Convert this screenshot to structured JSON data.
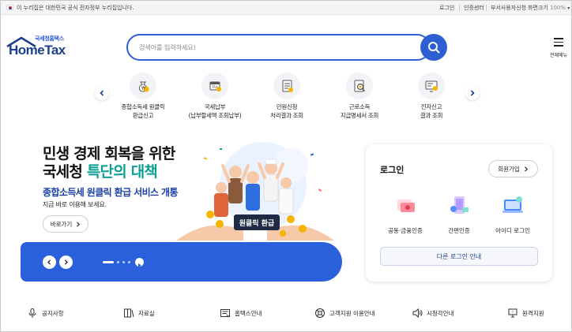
{
  "govbar": {
    "notice": "이 누리집은 대한민국 공식 전자정부 누리집입니다.",
    "links": [
      "로그인",
      "인증센터",
      "부서사용자신청"
    ],
    "zoom_label": "화면크기",
    "zoom_value": "100%"
  },
  "logo": {
    "sub": "국세청홈택스",
    "main": "HomeTax"
  },
  "search": {
    "placeholder": "검색어를 입력하세요!"
  },
  "allmenu": {
    "label": "전체메뉴"
  },
  "quick_menu": [
    {
      "line1": "종합소득세 원클릭",
      "line2": "환급신고",
      "icon": "money-bag-icon"
    },
    {
      "line1": "국세납부",
      "line2": "(납부할세액 조회납부)",
      "icon": "tax-bill-icon"
    },
    {
      "line1": "민원신청",
      "line2": "처리결과 조회",
      "icon": "document-list-icon"
    },
    {
      "line1": "근로소득",
      "line2": "지급명세서 조회",
      "icon": "document-search-icon"
    },
    {
      "line1": "전자신고",
      "line2": "결과 조회",
      "icon": "monitor-check-icon"
    }
  ],
  "hero": {
    "title_line1": "민생 경제 회복을 위한",
    "title_line2_a": "국세청 ",
    "title_line2_b": "특단의 대책",
    "subtitle": "종합소득세 원클릭 환급 서비스 개통",
    "desc": "지금 바로 이용해 보세요.",
    "button": "바로가기",
    "sign_text": "원클릭 환급",
    "slide_dots": 4
  },
  "login": {
    "title": "로그인",
    "join": "회원가입",
    "options": [
      {
        "label": "공동·금융인증",
        "icon": "certificate-icon"
      },
      {
        "label": "간편인증",
        "icon": "phone-auth-icon"
      },
      {
        "label": "아이디 로그인",
        "icon": "id-login-icon"
      }
    ],
    "other": "다른 로그인 안내"
  },
  "bottom_links": [
    {
      "label": "공지사항",
      "icon": "microphone-icon"
    },
    {
      "label": "자료실",
      "icon": "archive-icon"
    },
    {
      "label": "홈택스안내",
      "icon": "guide-icon"
    },
    {
      "label": "고객지원 이용안내",
      "icon": "support-icon"
    },
    {
      "label": "시청각안내",
      "icon": "speaker-icon"
    },
    {
      "label": "원격지원",
      "icon": "remote-support-icon"
    }
  ],
  "colors": {
    "primary": "#2d5fd3",
    "navy": "#1d3f8f",
    "teal": "#0e9f94",
    "hero_bar": "#2b60dc"
  }
}
